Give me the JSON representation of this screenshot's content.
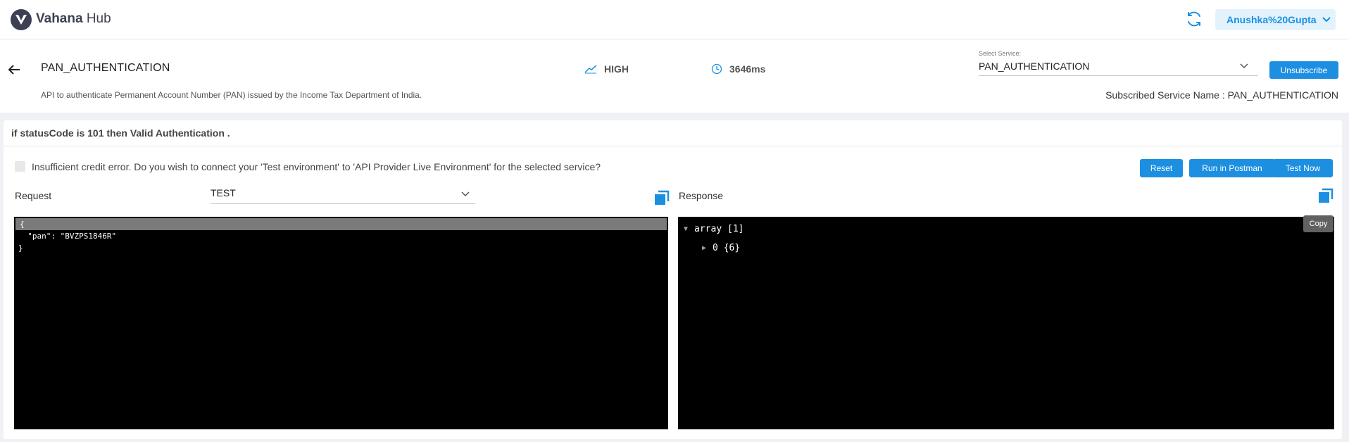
{
  "app": {
    "brand_bold": "Vahana",
    "brand_light": " Hub",
    "user": "Anushka%20Gupta"
  },
  "service": {
    "title": "PAN_AUTHENTICATION",
    "description": "API to authenticate Permanent Account Number (PAN) issued by the Income Tax Department of India.",
    "traffic": "HIGH",
    "latency": "3646ms",
    "select_label": "Select Service:",
    "selected": "PAN_AUTHENTICATION",
    "unsubscribe": "Unsubscribe",
    "subscribed_name": "Subscribed Service Name : PAN_AUTHENTICATION"
  },
  "console": {
    "status_note": "if statusCode is 101 then Valid Authentication .",
    "credit_message": "Insufficient credit error. Do you wish to connect your 'Test environment' to 'API Provider Live Environment' for the selected service?",
    "reset": "Reset",
    "run_postman": "Run in Postman",
    "test_now": "Test Now",
    "request_label": "Request",
    "environment": "TEST",
    "response_label": "Response",
    "copy_tooltip": "Copy",
    "request_lines": [
      "{",
      "  \"pan\": \"BVZPS1846R\"",
      "}"
    ],
    "response_root": "array [1]",
    "response_child": "0 {6}"
  },
  "colors": {
    "accent": "#1d8fe1",
    "brand_dark": "#3d3f52"
  },
  "icons": [
    "vahana-logo-icon",
    "refresh-icon",
    "chevron-down-icon",
    "back-arrow-icon",
    "trend-icon",
    "clock-icon",
    "copy-icon",
    "expand-triangle-icon"
  ]
}
